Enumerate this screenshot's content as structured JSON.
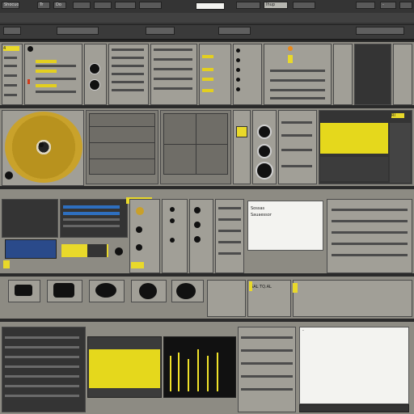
{
  "toolbar": {
    "menu_label": "Shocuo",
    "tab_a": "Tr",
    "tab_b": "Do",
    "search_value": "",
    "preset_label": "Ihup",
    "right_label": "-"
  },
  "left_panel": {
    "badge": "4",
    "rows": [
      "",
      "",
      "",
      "",
      "",
      ""
    ]
  },
  "mid_section": {
    "title_1": "Ss",
    "title_2": "Ls"
  },
  "dialog_small": {
    "line1": "Sossas",
    "line2": "Sauaessor"
  },
  "right_strip": {
    "label": "Rl",
    "value": "1"
  },
  "row4": {
    "label": "SAL TQ.AL"
  },
  "bottom_dialog": {
    "label": "-"
  },
  "colors": {
    "accent": "#e9d92a",
    "panel": "#8d8b83",
    "dark": "#343434"
  }
}
